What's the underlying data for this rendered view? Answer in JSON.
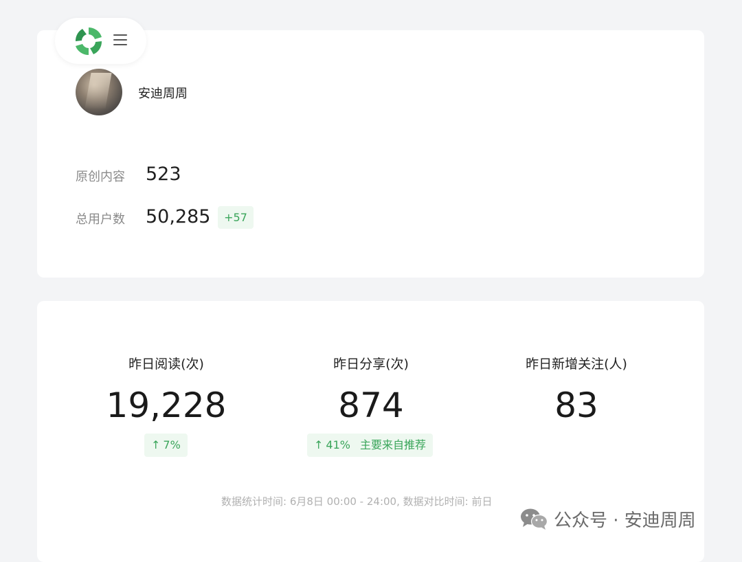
{
  "header": {
    "logo_icon": "app-logo-icon",
    "menu_icon": "hamburger-menu-icon"
  },
  "account": {
    "name": "安迪周周",
    "stats": [
      {
        "label": "原创内容",
        "value": "523"
      },
      {
        "label": "总用户数",
        "value": "50,285",
        "delta": "+57"
      }
    ]
  },
  "metrics": [
    {
      "label": "昨日阅读(次)",
      "value": "19,228",
      "trend": "7%",
      "arrow": "↑"
    },
    {
      "label": "昨日分享(次)",
      "value": "874",
      "trend": "41%",
      "arrow": "↑",
      "source": "主要来自推荐"
    },
    {
      "label": "昨日新增关注(人)",
      "value": "83"
    }
  ],
  "footnote": "数据统计时间: 6月8日 00:00 - 24:00, 数据对比时间: 前日",
  "watermark": {
    "icon": "wechat-icon",
    "text": "公众号 · 安迪周周"
  },
  "colors": {
    "accent_green": "#3aa55a",
    "badge_bg": "#eef8f0",
    "page_bg": "#f3f4f6"
  }
}
